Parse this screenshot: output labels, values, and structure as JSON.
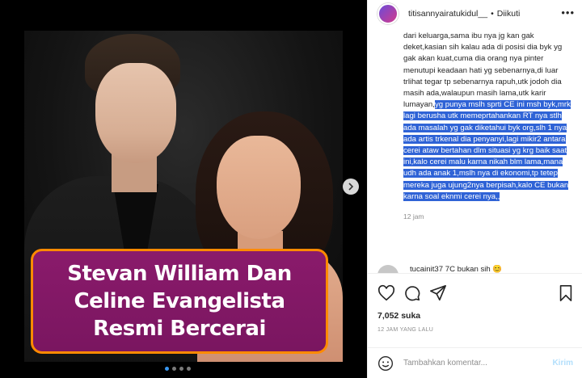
{
  "media": {
    "caption_lines": [
      "Stevan William Dan",
      "Celine Evangelista",
      "Resmi Bercerai"
    ],
    "carousel_dots": 4,
    "active_dot": 0
  },
  "header": {
    "username": "titisannyairatukidul__",
    "separator": "•",
    "follow_label": "Diikuti",
    "more_icon": "more-dots-icon"
  },
  "comment": {
    "text_plain": "dari keluarga,sama ibu nya jg kan gak deket,kasian sih kalau ada di posisi dia byk yg gak akan kuat,cuma dia orang nya pinter menutupi keadaan hati yg sebenarnya,di luar trlihat tegar tp sebenarnya rapuh,utk jodoh dia masih ada,walaupun masih lama,utk karir lumayan,",
    "text_highlighted": "yg punya mslh sprti CE ini msh byk,mrk lagi berusha utk memeprtahankan RT nya stlh ada masalah yg gak diketahui byk org,slh 1 nya ada artis trkenal dia penyanyi,lagi mikir2 antara cerei ataw bertahan dlm situasi yg krg baik saat ini,kalo cerei malu karna nikah blm lama,mana udh ada anak 1,mslh nya di ekonomi,tp tetep mereka juga ujung2nya berpisah,kalo CE bukan karna soal eknmi cerei nya,,",
    "time": "12 jam"
  },
  "next_reply": {
    "preview": "tucainit37 7C bukan sih 😊"
  },
  "actions": {
    "icons": [
      "heart-icon",
      "comment-icon",
      "share-icon",
      "bookmark-icon"
    ]
  },
  "likes": "7,052 suka",
  "posted_ago": "12 JAM YANG LALU",
  "comment_box": {
    "placeholder": "Tambahkan komentar...",
    "post_label": "Kirim"
  },
  "colors": {
    "highlight": "#2f63d6",
    "caption_bg": "#8a1a6b",
    "caption_border": "#ff8a00",
    "post_disabled": "#b2dffc"
  }
}
